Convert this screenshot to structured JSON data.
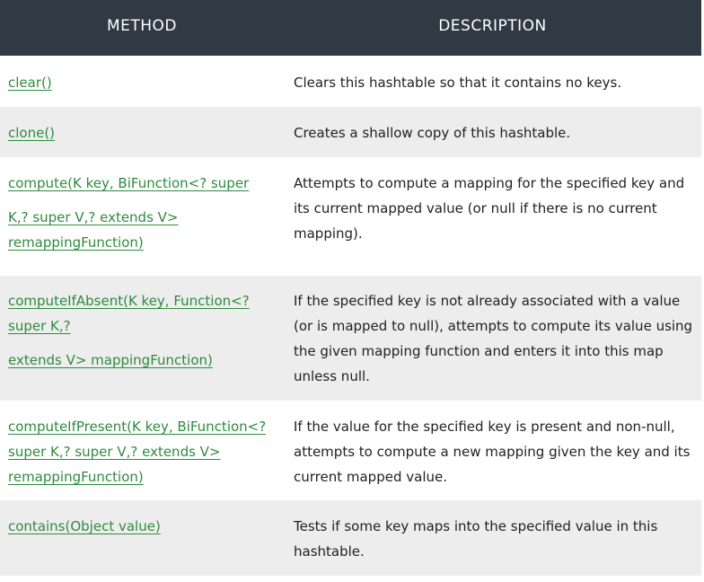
{
  "header": {
    "method": "METHOD",
    "description": "DESCRIPTION"
  },
  "rows": [
    {
      "method_lines": [
        "clear()"
      ],
      "description": "Clears this hashtable so that it contains no keys."
    },
    {
      "method_lines": [
        "clone()"
      ],
      "description": "Creates a shallow copy of this hashtable."
    },
    {
      "method_lines": [
        "compute(K key, BiFunction<? super",
        "K,? super V,? extends V>",
        "remappingFunction)"
      ],
      "description": "Attempts to compute a mapping for the specified key and its current mapped value (or null if there is no current mapping)."
    },
    {
      "method_lines": [
        "computeIfAbsent(K key, Function<?",
        "super K,?",
        "extends V> mappingFunction)"
      ],
      "description": "If the specified key is not already associated with a value (or is mapped to null), attempts to compute its value using the given mapping function and enters it into this map unless null."
    },
    {
      "method_lines": [
        "computeIfPresent(K key, BiFunction<?",
        "super K,? super V,? extends V>",
        "remappingFunction)"
      ],
      "description": "If the value for the specified key is present and non-null, attempts to compute a new mapping given the key and its current mapped value."
    },
    {
      "method_lines": [
        "contains(Object value)"
      ],
      "description": "Tests if some key maps into the specified value in this hashtable."
    }
  ]
}
